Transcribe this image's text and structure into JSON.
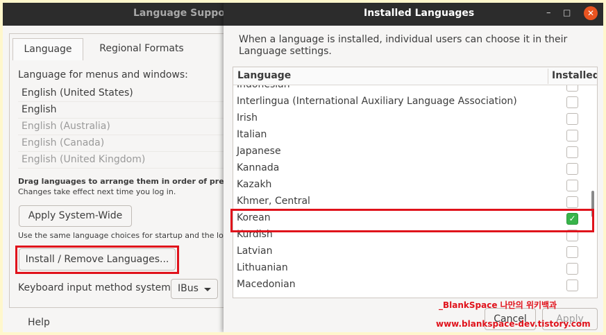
{
  "language_support": {
    "title": "Language Support",
    "tabs": [
      {
        "label": "Language"
      },
      {
        "label": "Regional Formats"
      }
    ],
    "menus_label": "Language for menus and windows:",
    "languages": [
      {
        "label": "English (United States)",
        "dim": false
      },
      {
        "label": "English",
        "dim": false
      },
      {
        "label": "English (Australia)",
        "dim": true
      },
      {
        "label": "English (Canada)",
        "dim": true
      },
      {
        "label": "English (United Kingdom)",
        "dim": true
      }
    ],
    "drag_note": "Drag languages to arrange them in order of prefere",
    "changes_note": "Changes take effect next time you log in.",
    "apply_system_wide": "Apply System-Wide",
    "same_note": "Use the same language choices for startup and the log",
    "install_remove": "Install / Remove Languages...",
    "keyboard_label": "Keyboard input method system:",
    "keyboard_value": "IBus",
    "help": "Help"
  },
  "installed_languages": {
    "title": "Installed Languages",
    "window_controls": {
      "minimize": "–",
      "maximize": "□",
      "close": "✕"
    },
    "intro": "When a language is installed, individual users can choose it in their Language settings.",
    "columns": {
      "language": "Language",
      "installed": "Installed"
    },
    "rows": [
      {
        "label": "Indonesian",
        "installed": false
      },
      {
        "label": "Interlingua (International Auxiliary Language Association)",
        "installed": false
      },
      {
        "label": "Irish",
        "installed": false
      },
      {
        "label": "Italian",
        "installed": false
      },
      {
        "label": "Japanese",
        "installed": false
      },
      {
        "label": "Kannada",
        "installed": false
      },
      {
        "label": "Kazakh",
        "installed": false
      },
      {
        "label": "Khmer, Central",
        "installed": false
      },
      {
        "label": "Korean",
        "installed": true
      },
      {
        "label": "Kurdish",
        "installed": false
      },
      {
        "label": "Latvian",
        "installed": false
      },
      {
        "label": "Lithuanian",
        "installed": false
      },
      {
        "label": "Macedonian",
        "installed": false
      }
    ],
    "cancel": "Cancel",
    "apply": "Apply"
  },
  "watermark": {
    "line1": "_BlankSpace 나만의 위키백과",
    "line2": "www.blankspace-dev.tistory.com"
  }
}
